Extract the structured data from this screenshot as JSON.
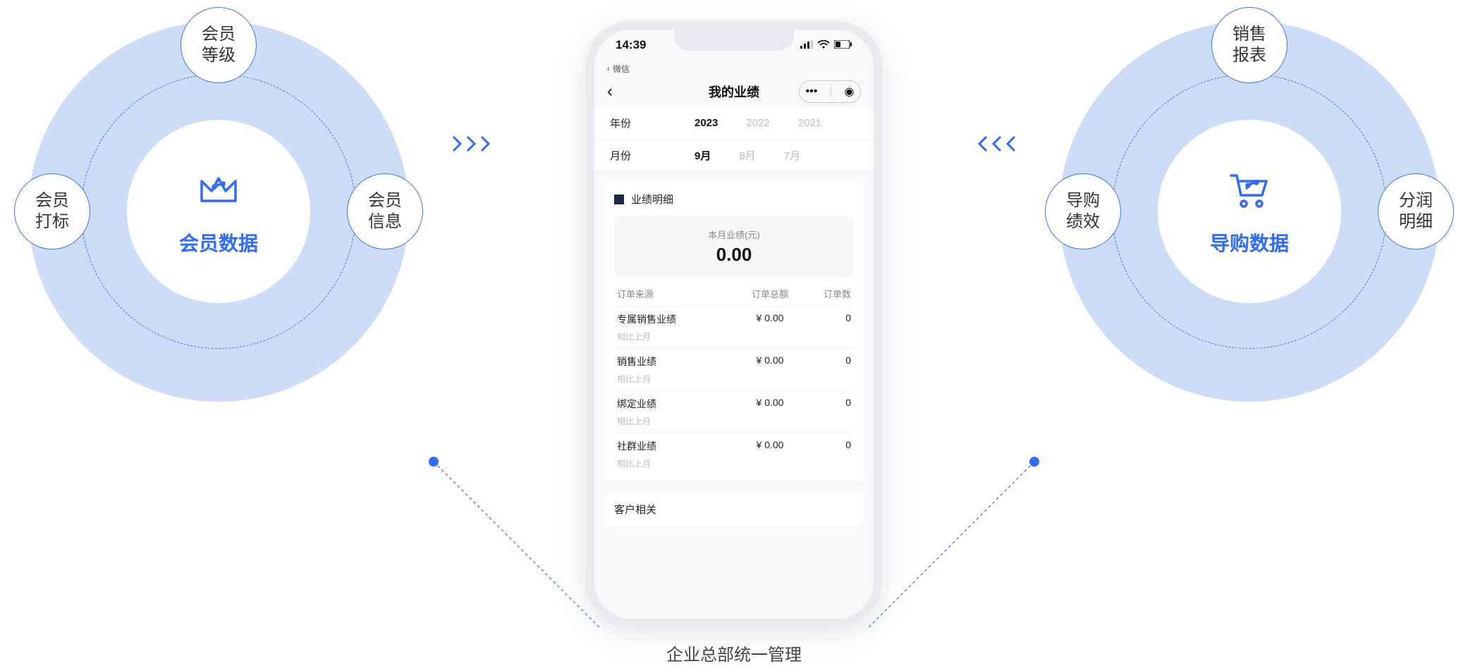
{
  "left": {
    "title": "会员数据",
    "top": "会员\n等级",
    "leftSat": "会员\n打标",
    "rightSat": "会员\n信息"
  },
  "right": {
    "title": "导购数据",
    "top": "销售\n报表",
    "leftSat": "导购\n绩效",
    "rightSat": "分润\n明细"
  },
  "phone": {
    "time": "14:39",
    "wxBack": "微信",
    "title": "我的业绩",
    "yearLabel": "年份",
    "yearOpts": [
      "2023",
      "2022",
      "2021"
    ],
    "monthLabel": "月份",
    "monthOpts": [
      "9月",
      "8月",
      "7月"
    ],
    "detailTitle": "业绩明细",
    "sumLabel": "本月业绩(元)",
    "sumVal": "0.00",
    "cols": [
      "订单来源",
      "订单总额",
      "订单数"
    ],
    "rows": [
      {
        "src": "专属销售业绩",
        "amt": "¥ 0.00",
        "cnt": "0",
        "cmp": "相比上月"
      },
      {
        "src": "销售业绩",
        "amt": "¥ 0.00",
        "cnt": "0",
        "cmp": "相比上月"
      },
      {
        "src": "绑定业绩",
        "amt": "¥ 0.00",
        "cnt": "0",
        "cmp": "相比上月"
      },
      {
        "src": "社群业绩",
        "amt": "¥ 0.00",
        "cnt": "0",
        "cmp": "相比上月"
      }
    ],
    "sect": "客户相关"
  },
  "caption": "企业总部统一管理"
}
